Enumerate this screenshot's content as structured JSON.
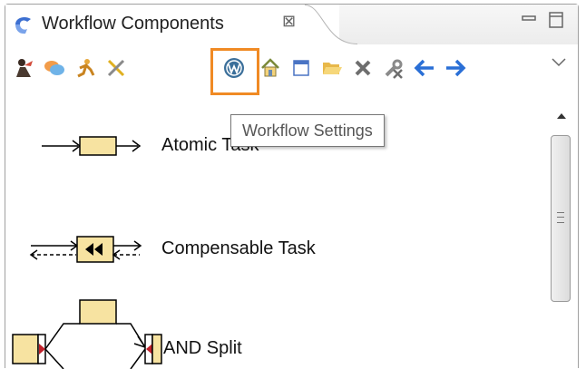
{
  "view": {
    "tab_title": "Workflow Components",
    "close_glyph": "⊠"
  },
  "toolbar": {
    "buttons": [
      {
        "name": "worker-icon"
      },
      {
        "name": "chat-bubbles-icon"
      },
      {
        "name": "runner-icon"
      },
      {
        "name": "tools-icon"
      },
      {
        "name": "wordpress-icon"
      },
      {
        "name": "home-icon"
      },
      {
        "name": "window-icon"
      },
      {
        "name": "folder-open-icon"
      },
      {
        "name": "delete-icon"
      },
      {
        "name": "wrench-delete-icon"
      },
      {
        "name": "back-arrow-icon"
      },
      {
        "name": "forward-arrow-icon"
      }
    ],
    "highlighted": "wordpress-icon"
  },
  "tooltip": {
    "text": "Workflow Settings"
  },
  "palette": {
    "items": [
      {
        "label": "Atomic Task"
      },
      {
        "label": "Compensable Task"
      },
      {
        "label": "AND Split"
      }
    ]
  },
  "colors": {
    "task_fill": "#f7e3a1",
    "highlight": "#f08a24",
    "arrow_blue": "#2a6fd6"
  }
}
